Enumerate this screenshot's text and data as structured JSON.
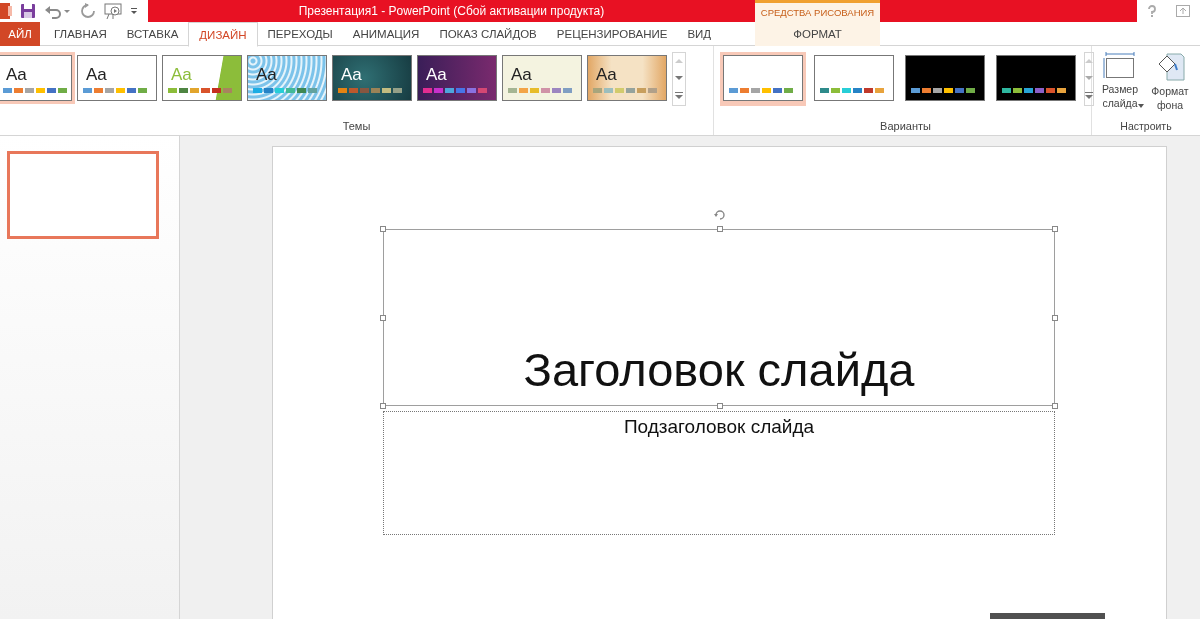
{
  "window": {
    "title": "Презентация1 -  PowerPoint (Сбой активации продукта)",
    "context_group": "СРЕДСТВА РИСОВАНИЯ"
  },
  "tabs": [
    {
      "label": "АЙЛ",
      "kind": "file",
      "selected": false
    },
    {
      "label": "ГЛАВНАЯ",
      "kind": "tab",
      "selected": false
    },
    {
      "label": "ВСТАВКА",
      "kind": "tab",
      "selected": false
    },
    {
      "label": "ДИЗАЙН",
      "kind": "tab",
      "selected": true
    },
    {
      "label": "ПЕРЕХОДЫ",
      "kind": "tab",
      "selected": false
    },
    {
      "label": "АНИМАЦИЯ",
      "kind": "tab",
      "selected": false
    },
    {
      "label": "ПОКАЗ СЛАЙДОВ",
      "kind": "tab",
      "selected": false
    },
    {
      "label": "РЕЦЕНЗИРОВАНИЕ",
      "kind": "tab",
      "selected": false
    },
    {
      "label": "ВИД",
      "kind": "tab",
      "selected": false
    },
    {
      "label": "ФОРМАТ",
      "kind": "context",
      "selected": false
    }
  ],
  "themes": {
    "label": "Темы",
    "items": [
      {
        "sample": "Aa",
        "kind": "office",
        "selected": true
      },
      {
        "sample": "Aa",
        "kind": "office",
        "selected": false
      },
      {
        "sample": "Aa",
        "kind": "green",
        "selected": false
      },
      {
        "sample": "Aa",
        "kind": "pattern",
        "selected": false
      },
      {
        "sample": "Aa",
        "kind": "teal",
        "selected": false
      },
      {
        "sample": "Aa",
        "kind": "purple",
        "selected": false
      },
      {
        "sample": "Aa",
        "kind": "cream",
        "selected": false
      },
      {
        "sample": "Aa",
        "kind": "wood",
        "selected": false
      }
    ]
  },
  "variants": {
    "label": "Варианты",
    "items": [
      {
        "kind": "white",
        "selected": true
      },
      {
        "kind": "white2",
        "selected": false
      },
      {
        "kind": "black",
        "selected": false
      },
      {
        "kind": "black2",
        "selected": false
      }
    ]
  },
  "customize": {
    "label": "Настроить",
    "buttons": [
      {
        "label": "Размер слайда",
        "dropdown": true,
        "kind": "size"
      },
      {
        "label": "Формат фона",
        "dropdown": false,
        "kind": "background"
      }
    ]
  },
  "slide": {
    "title": "Заголовок слайда",
    "subtitle": "Подзаголовок слайда"
  }
}
